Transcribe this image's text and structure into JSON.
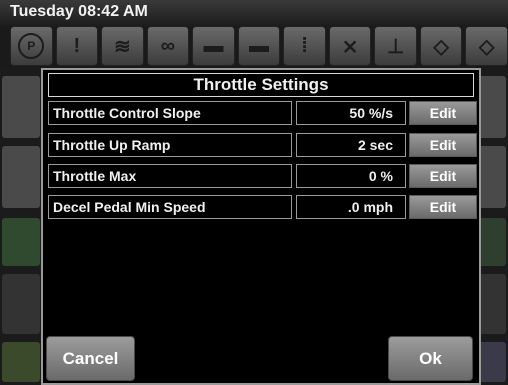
{
  "status": {
    "time": "Tuesday 08:42 AM"
  },
  "indicators": [
    {
      "icon": "parking-brake-icon",
      "glyph": "P"
    },
    {
      "icon": "warning-icon",
      "glyph": "!"
    },
    {
      "icon": "coolant-icon",
      "glyph": "≋"
    },
    {
      "icon": "oil-icon",
      "glyph": "∞"
    },
    {
      "icon": "battery-icon",
      "glyph": "▬"
    },
    {
      "icon": "charging-icon",
      "glyph": "▬"
    },
    {
      "icon": "filter-icon",
      "glyph": "⁞"
    },
    {
      "icon": "regen-off-icon",
      "glyph": "⨯"
    },
    {
      "icon": "fuel-level-icon",
      "glyph": "⊥"
    },
    {
      "icon": "engine-check-icon",
      "glyph": "◇"
    },
    {
      "icon": "engine-stop-icon",
      "glyph": "◇"
    }
  ],
  "dialog": {
    "title": "Throttle Settings",
    "rows": [
      {
        "label": "Throttle Control Slope",
        "value": "50 %/s",
        "edit": "Edit"
      },
      {
        "label": "Throttle Up Ramp",
        "value": "2 sec",
        "edit": "Edit"
      },
      {
        "label": "Throttle Max",
        "value": "0 %",
        "edit": "Edit"
      },
      {
        "label": "Decel Pedal Min Speed",
        "value": ".0 mph",
        "edit": "Edit"
      }
    ],
    "cancel": "Cancel",
    "ok": "Ok"
  }
}
